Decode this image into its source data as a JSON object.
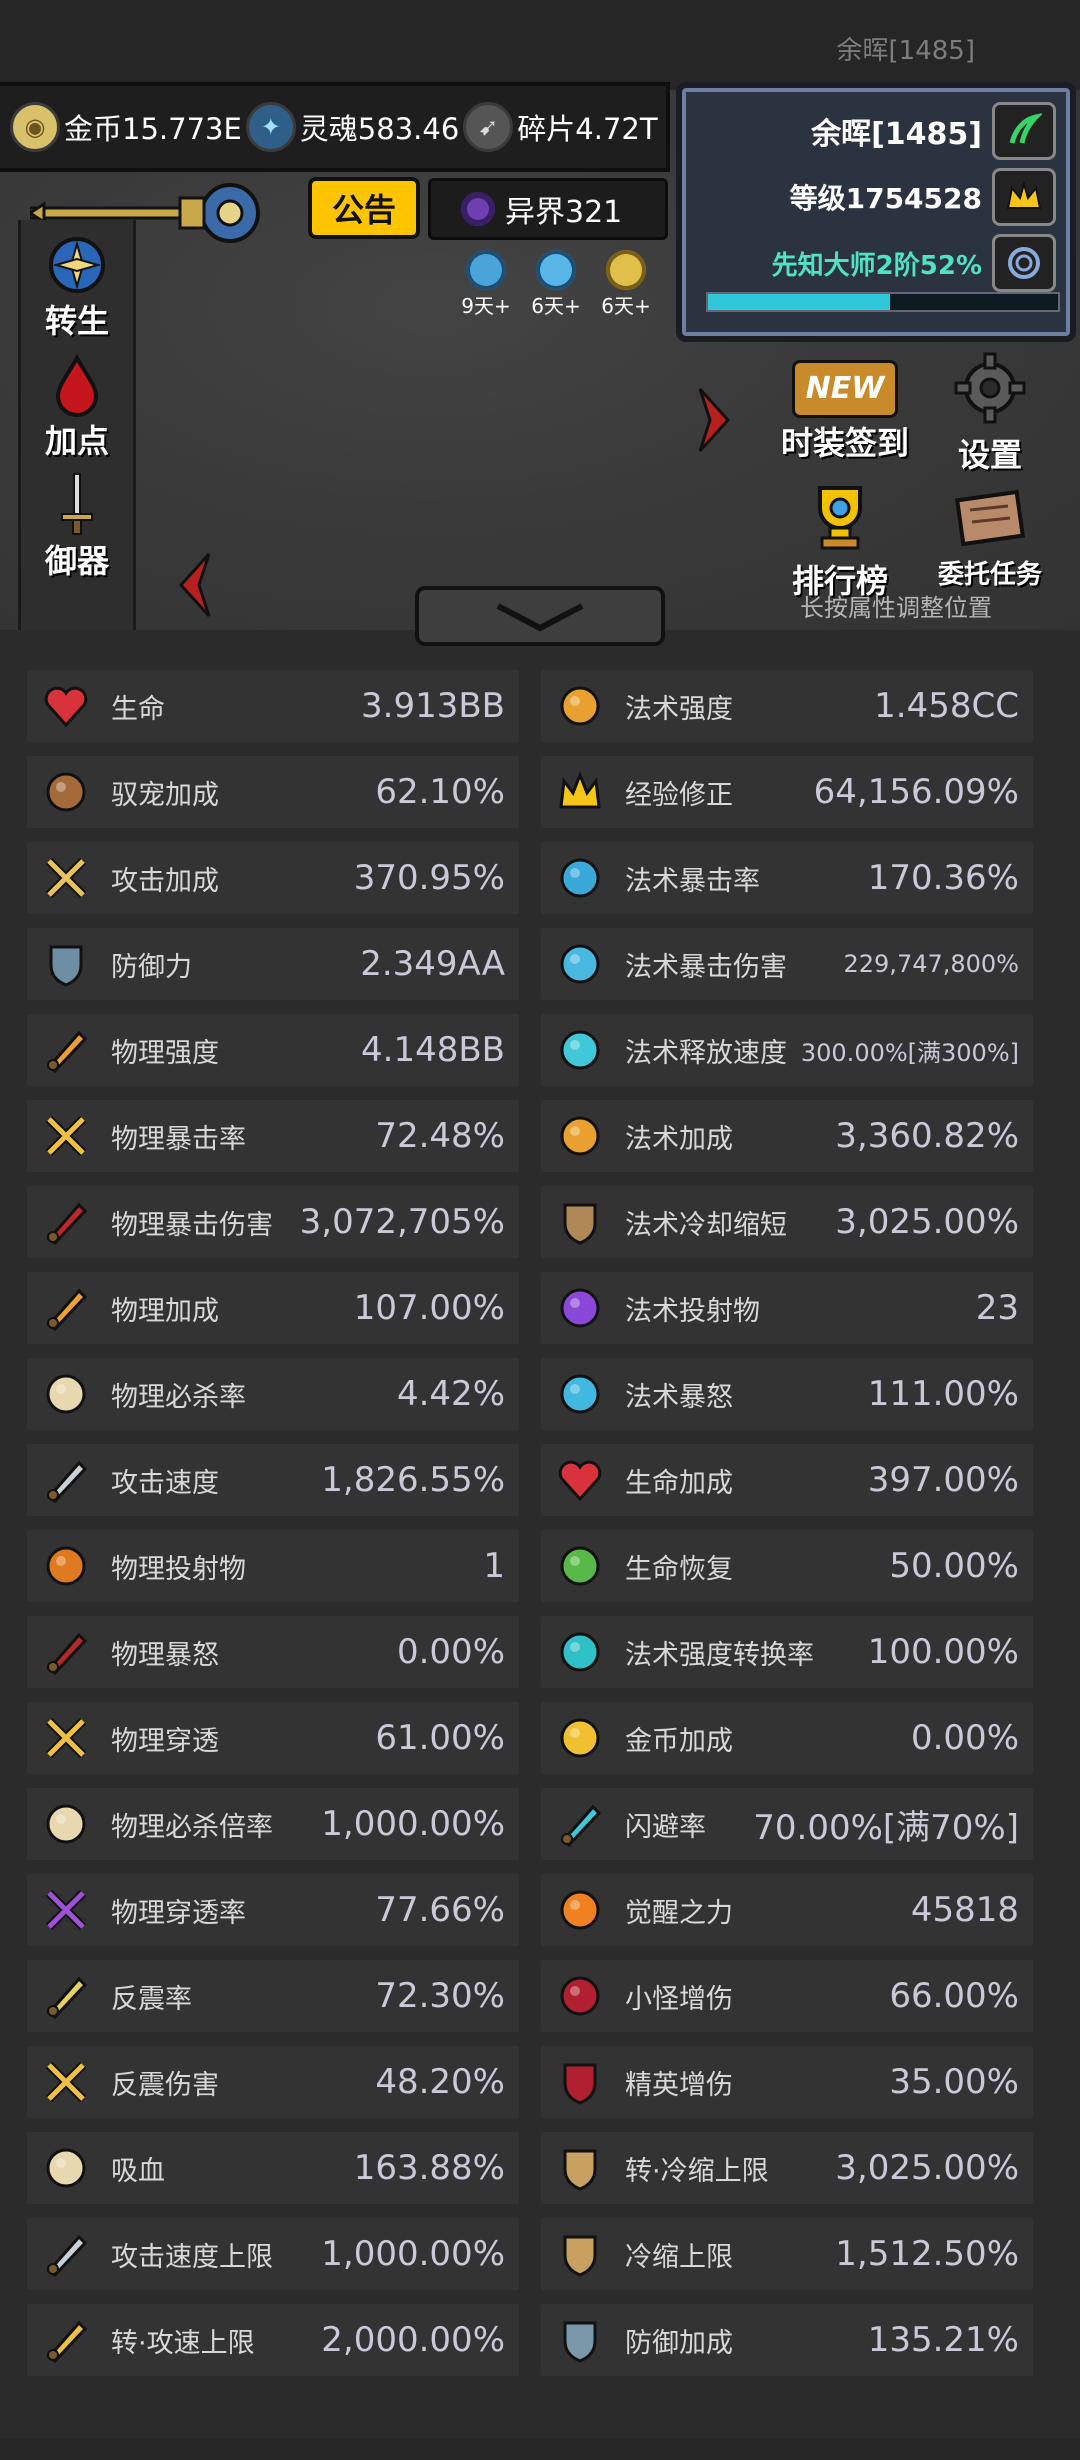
{
  "header": {
    "player_title": "余晖[1485]"
  },
  "resources": [
    {
      "icon": "coin-icon",
      "label": "金币15.773E"
    },
    {
      "icon": "soul-icon",
      "label": "灵魂583.46"
    },
    {
      "icon": "shard-icon",
      "label": "碎片4.72T"
    }
  ],
  "notice_label": "公告",
  "realm_label": "异界321",
  "timers": [
    "9天+",
    "6天+",
    "6天+"
  ],
  "side_menu": [
    "转生",
    "加点",
    "御器"
  ],
  "profile": {
    "name": "余晖[1485]",
    "level": "等级1754528",
    "prophet": "先知大师2阶52%",
    "progress": 0.52
  },
  "menu_buttons": {
    "new_badge": "NEW",
    "costume_checkin": "时装签到",
    "settings": "设置",
    "leaderboard": "排行榜",
    "commission": "委托任务"
  },
  "hint": "长按属性调整位置",
  "colors": {
    "accent_yellow": "#ffc400",
    "prophet_teal": "#4fe3c4",
    "stat_bg": "#333333"
  },
  "stats_left": [
    {
      "name": "生命",
      "value": "3.913BB",
      "icon": "heart-icon"
    },
    {
      "name": "驭宠加成",
      "value": "62.10%",
      "icon": "paw-icon"
    },
    {
      "name": "攻击加成",
      "value": "370.95%",
      "icon": "crossed-swords-icon"
    },
    {
      "name": "防御力",
      "value": "2.349AA",
      "icon": "shield-icon"
    },
    {
      "name": "物理强度",
      "value": "4.148BB",
      "icon": "flaming-arrow-icon"
    },
    {
      "name": "物理暴击率",
      "value": "72.48%",
      "icon": "crit-sword-icon"
    },
    {
      "name": "物理暴击伤害",
      "value": "3,072,705%",
      "icon": "bleeding-sword-icon"
    },
    {
      "name": "物理加成",
      "value": "107.00%",
      "icon": "sword-plus-icon"
    },
    {
      "name": "物理必杀率",
      "value": "4.42%",
      "icon": "skull-sword-icon"
    },
    {
      "name": "攻击速度",
      "value": "1,826.55%",
      "icon": "speed-sword-icon"
    },
    {
      "name": "物理投射物",
      "value": "1",
      "icon": "boomerang-icon"
    },
    {
      "name": "物理暴怒",
      "value": "0.00%",
      "icon": "rage-sword-icon"
    },
    {
      "name": "物理穿透",
      "value": "61.00%",
      "icon": "pierce-sword-icon"
    },
    {
      "name": "物理必杀倍率",
      "value": "1,000.00%",
      "icon": "skull-multiplier-icon"
    },
    {
      "name": "物理穿透率",
      "value": "77.66%",
      "icon": "purple-pierce-icon"
    },
    {
      "name": "反震率",
      "value": "72.30%",
      "icon": "recoil-icon"
    },
    {
      "name": "反震伤害",
      "value": "48.20%",
      "icon": "recoil-damage-icon"
    },
    {
      "name": "吸血",
      "value": "163.88%",
      "icon": "vampire-skull-icon"
    },
    {
      "name": "攻击速度上限",
      "value": "1,000.00%",
      "icon": "speed-cap-icon"
    },
    {
      "name": "转·攻速上限",
      "value": "2,000.00%",
      "icon": "golden-sword-icon"
    }
  ],
  "stats_right": [
    {
      "name": "法术强度",
      "value": "1.458CC",
      "icon": "magic-power-icon"
    },
    {
      "name": "经验修正",
      "value": "64,156.09%",
      "icon": "crown-icon"
    },
    {
      "name": "法术暴击率",
      "value": "170.36%",
      "icon": "blue-flame-icon"
    },
    {
      "name": "法术暴击伤害",
      "value": "229,747,800%",
      "icon": "magic-orb-icon",
      "small": true
    },
    {
      "name": "法术释放速度",
      "value": "300.00%[满300%]",
      "icon": "mushroom-icon",
      "small": true
    },
    {
      "name": "法术加成",
      "value": "3,360.82%",
      "icon": "magic-plus-icon"
    },
    {
      "name": "法术冷却缩短",
      "value": "3,025.00%",
      "icon": "hourglass-icon"
    },
    {
      "name": "法术投射物",
      "value": "23",
      "icon": "purple-flame-icon"
    },
    {
      "name": "法术暴怒",
      "value": "111.00%",
      "icon": "magic-rage-icon"
    },
    {
      "name": "生命加成",
      "value": "397.00%",
      "icon": "heart-plus-icon"
    },
    {
      "name": "生命恢复",
      "value": "50.00%",
      "icon": "sprout-icon"
    },
    {
      "name": "法术强度转换率",
      "value": "100.00%",
      "icon": "conversion-icon"
    },
    {
      "name": "金币加成",
      "value": "0.00%",
      "icon": "coins-icon"
    },
    {
      "name": "闪避率",
      "value": "70.00%[满70%]",
      "icon": "dodge-icon"
    },
    {
      "name": "觉醒之力",
      "value": "45818",
      "icon": "awakening-icon"
    },
    {
      "name": "小怪增伤",
      "value": "66.00%",
      "icon": "demon-icon"
    },
    {
      "name": "精英增伤",
      "value": "35.00%",
      "icon": "elite-helmet-icon"
    },
    {
      "name": "转·冷缩上限",
      "value": "3,025.00%",
      "icon": "hourglass-up-icon"
    },
    {
      "name": "冷缩上限",
      "value": "1,512.50%",
      "icon": "hourglass-cap-icon"
    },
    {
      "name": "防御加成",
      "value": "135.21%",
      "icon": "shield-plus-icon"
    }
  ]
}
